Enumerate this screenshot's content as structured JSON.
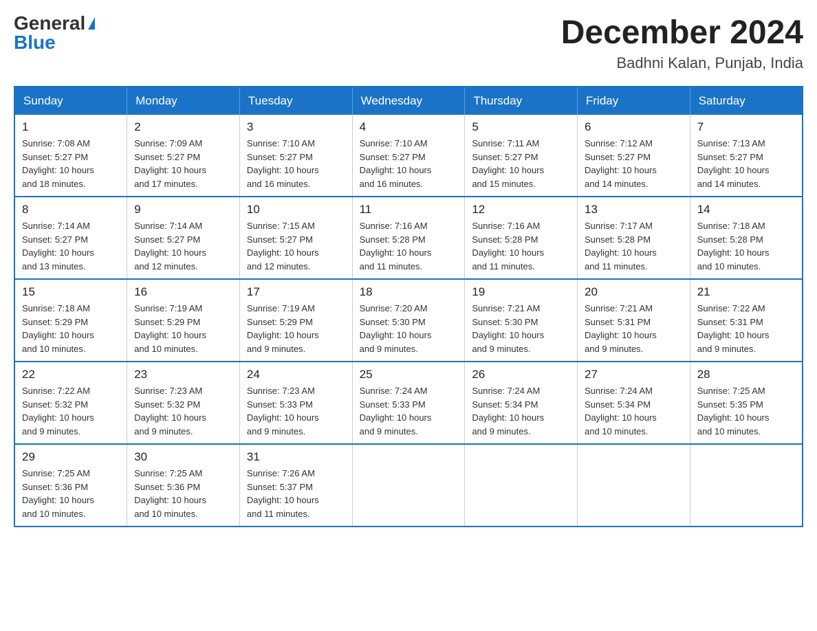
{
  "header": {
    "logo_general": "General",
    "logo_blue": "Blue",
    "month_title": "December 2024",
    "location": "Badhni Kalan, Punjab, India"
  },
  "days_of_week": [
    "Sunday",
    "Monday",
    "Tuesday",
    "Wednesday",
    "Thursday",
    "Friday",
    "Saturday"
  ],
  "weeks": [
    [
      {
        "day": "1",
        "sunrise": "7:08 AM",
        "sunset": "5:27 PM",
        "daylight": "10 hours and 18 minutes."
      },
      {
        "day": "2",
        "sunrise": "7:09 AM",
        "sunset": "5:27 PM",
        "daylight": "10 hours and 17 minutes."
      },
      {
        "day": "3",
        "sunrise": "7:10 AM",
        "sunset": "5:27 PM",
        "daylight": "10 hours and 16 minutes."
      },
      {
        "day": "4",
        "sunrise": "7:10 AM",
        "sunset": "5:27 PM",
        "daylight": "10 hours and 16 minutes."
      },
      {
        "day": "5",
        "sunrise": "7:11 AM",
        "sunset": "5:27 PM",
        "daylight": "10 hours and 15 minutes."
      },
      {
        "day": "6",
        "sunrise": "7:12 AM",
        "sunset": "5:27 PM",
        "daylight": "10 hours and 14 minutes."
      },
      {
        "day": "7",
        "sunrise": "7:13 AM",
        "sunset": "5:27 PM",
        "daylight": "10 hours and 14 minutes."
      }
    ],
    [
      {
        "day": "8",
        "sunrise": "7:14 AM",
        "sunset": "5:27 PM",
        "daylight": "10 hours and 13 minutes."
      },
      {
        "day": "9",
        "sunrise": "7:14 AM",
        "sunset": "5:27 PM",
        "daylight": "10 hours and 12 minutes."
      },
      {
        "day": "10",
        "sunrise": "7:15 AM",
        "sunset": "5:27 PM",
        "daylight": "10 hours and 12 minutes."
      },
      {
        "day": "11",
        "sunrise": "7:16 AM",
        "sunset": "5:28 PM",
        "daylight": "10 hours and 11 minutes."
      },
      {
        "day": "12",
        "sunrise": "7:16 AM",
        "sunset": "5:28 PM",
        "daylight": "10 hours and 11 minutes."
      },
      {
        "day": "13",
        "sunrise": "7:17 AM",
        "sunset": "5:28 PM",
        "daylight": "10 hours and 11 minutes."
      },
      {
        "day": "14",
        "sunrise": "7:18 AM",
        "sunset": "5:28 PM",
        "daylight": "10 hours and 10 minutes."
      }
    ],
    [
      {
        "day": "15",
        "sunrise": "7:18 AM",
        "sunset": "5:29 PM",
        "daylight": "10 hours and 10 minutes."
      },
      {
        "day": "16",
        "sunrise": "7:19 AM",
        "sunset": "5:29 PM",
        "daylight": "10 hours and 10 minutes."
      },
      {
        "day": "17",
        "sunrise": "7:19 AM",
        "sunset": "5:29 PM",
        "daylight": "10 hours and 9 minutes."
      },
      {
        "day": "18",
        "sunrise": "7:20 AM",
        "sunset": "5:30 PM",
        "daylight": "10 hours and 9 minutes."
      },
      {
        "day": "19",
        "sunrise": "7:21 AM",
        "sunset": "5:30 PM",
        "daylight": "10 hours and 9 minutes."
      },
      {
        "day": "20",
        "sunrise": "7:21 AM",
        "sunset": "5:31 PM",
        "daylight": "10 hours and 9 minutes."
      },
      {
        "day": "21",
        "sunrise": "7:22 AM",
        "sunset": "5:31 PM",
        "daylight": "10 hours and 9 minutes."
      }
    ],
    [
      {
        "day": "22",
        "sunrise": "7:22 AM",
        "sunset": "5:32 PM",
        "daylight": "10 hours and 9 minutes."
      },
      {
        "day": "23",
        "sunrise": "7:23 AM",
        "sunset": "5:32 PM",
        "daylight": "10 hours and 9 minutes."
      },
      {
        "day": "24",
        "sunrise": "7:23 AM",
        "sunset": "5:33 PM",
        "daylight": "10 hours and 9 minutes."
      },
      {
        "day": "25",
        "sunrise": "7:24 AM",
        "sunset": "5:33 PM",
        "daylight": "10 hours and 9 minutes."
      },
      {
        "day": "26",
        "sunrise": "7:24 AM",
        "sunset": "5:34 PM",
        "daylight": "10 hours and 9 minutes."
      },
      {
        "day": "27",
        "sunrise": "7:24 AM",
        "sunset": "5:34 PM",
        "daylight": "10 hours and 10 minutes."
      },
      {
        "day": "28",
        "sunrise": "7:25 AM",
        "sunset": "5:35 PM",
        "daylight": "10 hours and 10 minutes."
      }
    ],
    [
      {
        "day": "29",
        "sunrise": "7:25 AM",
        "sunset": "5:36 PM",
        "daylight": "10 hours and 10 minutes."
      },
      {
        "day": "30",
        "sunrise": "7:25 AM",
        "sunset": "5:36 PM",
        "daylight": "10 hours and 10 minutes."
      },
      {
        "day": "31",
        "sunrise": "7:26 AM",
        "sunset": "5:37 PM",
        "daylight": "10 hours and 11 minutes."
      },
      null,
      null,
      null,
      null
    ]
  ],
  "labels": {
    "sunrise": "Sunrise:",
    "sunset": "Sunset:",
    "daylight": "Daylight:"
  }
}
